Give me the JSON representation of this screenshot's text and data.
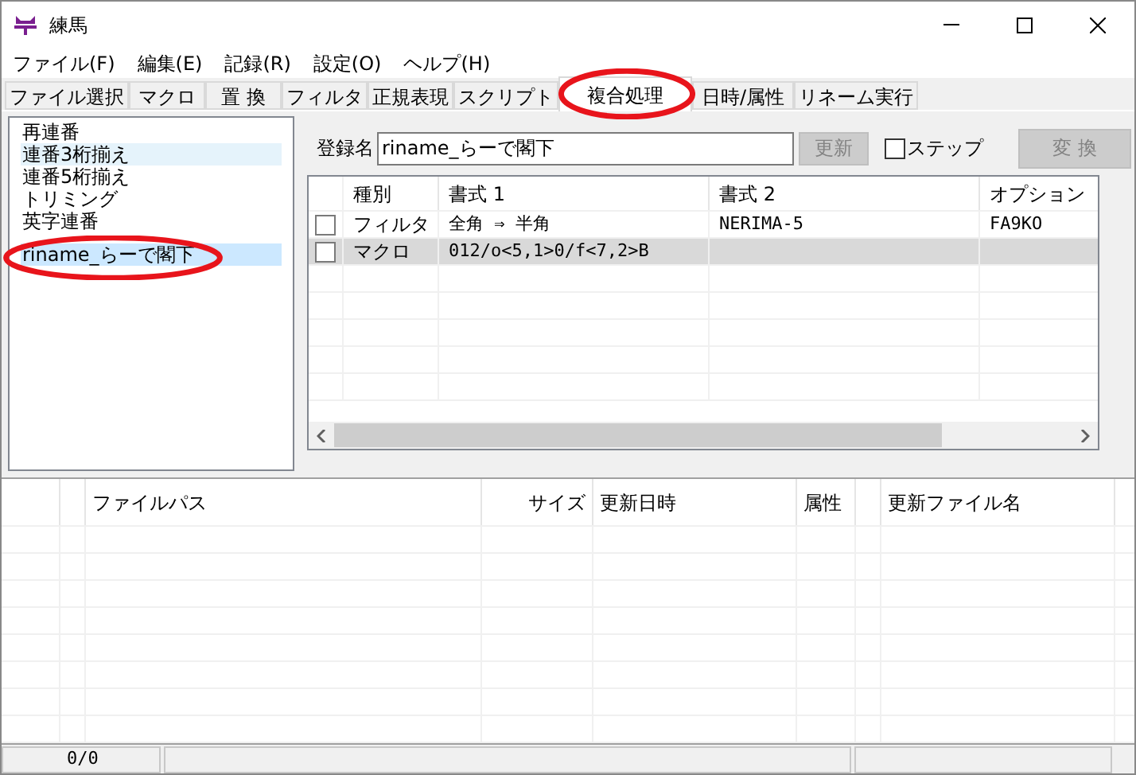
{
  "window": {
    "title": "練馬"
  },
  "menu": [
    "ファイル(F)",
    "編集(E)",
    "記録(R)",
    "設定(O)",
    "ヘルプ(H)"
  ],
  "tabs": [
    {
      "label": "ファイル選択",
      "selected": false,
      "circled": false
    },
    {
      "label": "マクロ",
      "selected": false,
      "circled": false
    },
    {
      "label": "置 換",
      "selected": false,
      "circled": false
    },
    {
      "label": "フィルタ",
      "selected": false,
      "circled": false
    },
    {
      "label": "正規表現",
      "selected": false,
      "circled": false
    },
    {
      "label": "スクリプト",
      "selected": false,
      "circled": false
    },
    {
      "label": "複合処理",
      "selected": true,
      "circled": true
    },
    {
      "label": "日時/属性",
      "selected": false,
      "circled": false
    },
    {
      "label": "リネーム実行",
      "selected": false,
      "circled": false
    }
  ],
  "macros": [
    {
      "label": "再連番",
      "selected": false,
      "hovered": false,
      "circled": false
    },
    {
      "label": "連番3桁揃え",
      "selected": false,
      "hovered": true,
      "circled": false
    },
    {
      "label": "連番5桁揃え",
      "selected": false,
      "hovered": false,
      "circled": false
    },
    {
      "label": "トリミング",
      "selected": false,
      "hovered": false,
      "circled": false
    },
    {
      "label": "英字連番",
      "selected": false,
      "hovered": false,
      "circled": false
    },
    {
      "label": "riname_らーで閣下",
      "selected": true,
      "hovered": false,
      "circled": true
    }
  ],
  "editor": {
    "name_label": "登録名",
    "name_value": "riname_らーで閣下",
    "update_button": {
      "label": "更新",
      "disabled": true
    },
    "step": {
      "label": "ステップ",
      "checked": false
    },
    "convert_button": {
      "label": "変 換",
      "disabled": true
    }
  },
  "steps_table": {
    "columns": [
      "種別",
      "書式 1",
      "書式 2",
      "オプション"
    ],
    "rows": [
      {
        "checked": false,
        "selected": false,
        "cells": [
          "フィルタ",
          "全角 ⇒ 半角",
          "NERIMA-5",
          "FA9KO"
        ]
      },
      {
        "checked": false,
        "selected": true,
        "cells": [
          "マクロ",
          "012/o<5,1>0/f<7,2>B",
          "",
          ""
        ]
      }
    ]
  },
  "files_table": {
    "columns": [
      "ファイルパス",
      "サイズ",
      "更新日時",
      "属性",
      "更新ファイル名"
    ]
  },
  "status_bar": [
    "0/0"
  ]
}
